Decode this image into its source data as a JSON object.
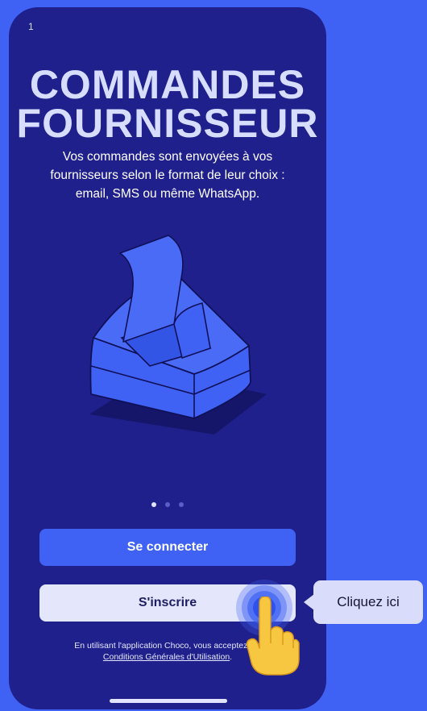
{
  "status": {
    "indicator": "1"
  },
  "onboarding": {
    "title_line1": "COMMANDES",
    "title_line2": "FOURNISSEUR",
    "subtitle_line1": "Vos commandes sont envoyées à vos",
    "subtitle_line2": "fournisseurs selon le format de leur choix :",
    "subtitle_line3": "email, SMS ou même WhatsApp.",
    "pagination": {
      "total": 3,
      "active_index": 0
    }
  },
  "actions": {
    "login_label": "Se connecter",
    "signup_label": "S'inscrire"
  },
  "legal": {
    "text": "En utilisant l'application Choco, vous acceptez les",
    "link": "Conditions Générales d'Utilisation",
    "suffix": "."
  },
  "tooltip": {
    "label": "Cliquez ici"
  },
  "colors": {
    "outer_background": "#3f62f4",
    "screen_background": "#20208c",
    "primary_button": "#3f62f4",
    "secondary_button": "#e4e6fb",
    "illustration": "#3f62f4",
    "tooltip": "#d9ddfb"
  },
  "icons": {
    "illustration": "printer-receipt-illustration",
    "pointer": "pointing-hand-icon"
  }
}
